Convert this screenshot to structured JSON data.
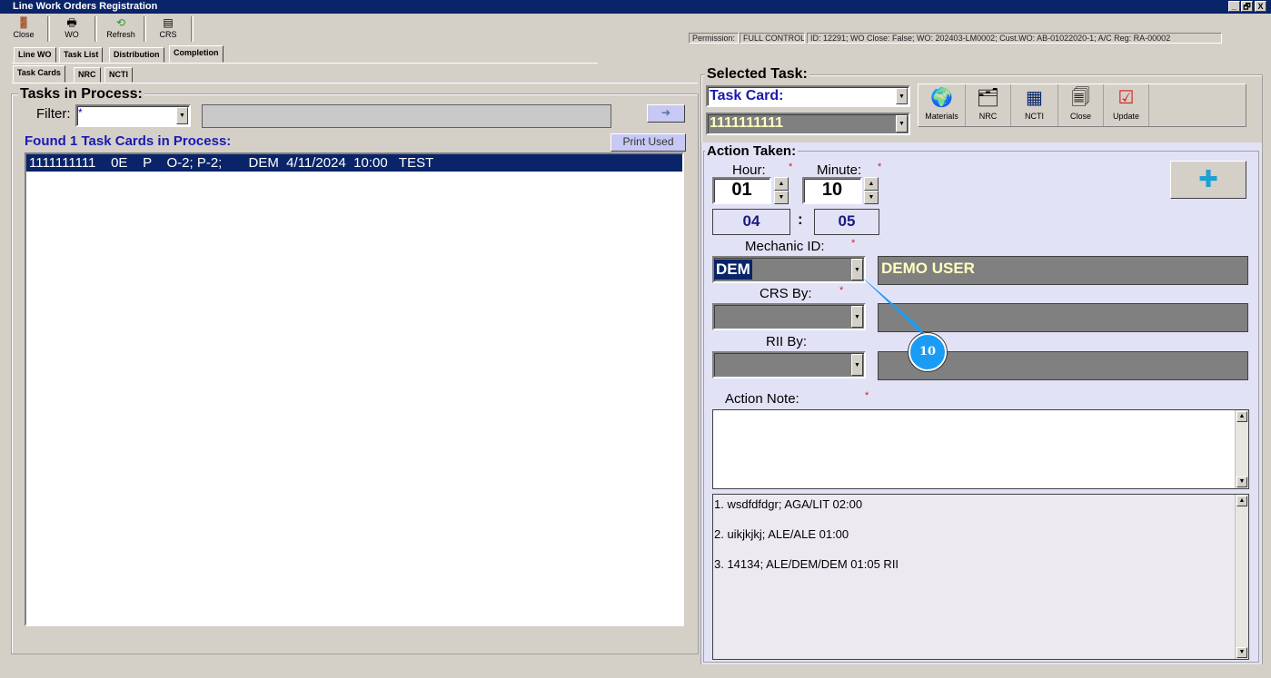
{
  "window": {
    "title": "Line Work Orders Registration",
    "min": "_",
    "max": "🗗",
    "close": "X"
  },
  "toolbar": [
    {
      "label": "Close",
      "icon": "door-exit-icon"
    },
    {
      "label": "WO",
      "icon": "printer-icon"
    },
    {
      "label": "Refresh",
      "icon": "refresh-icon"
    },
    {
      "label": "CRS",
      "icon": "form-edit-icon"
    }
  ],
  "status": {
    "permission_label": "Permission:",
    "permission_value": "FULL CONTROL",
    "info": "ID: 12291; WO Close: False; WO: 202403-LM0002; Cust.WO: AB-01022020-1; A/C Reg: RA-00002"
  },
  "tabs": [
    "Line WO",
    "Task List",
    "Distribution",
    "Completion"
  ],
  "subtabs": [
    "Task Cards",
    "NRC",
    "NCTI"
  ],
  "left": {
    "title": "Tasks in Process:",
    "filter_label": "Filter:",
    "filter_value": "*",
    "arrow": "➔",
    "found": "Found 1 Task Cards in Process:",
    "print_used": "Print Used",
    "rows": [
      "1111111111    0E    P    O-2; P-2;       DEM  4/11/2024  10:00   TEST"
    ]
  },
  "selected": {
    "title": "Selected Task:",
    "type": "Task Card:",
    "number": "1111111111",
    "buttons": [
      {
        "label": "Materials",
        "icon": "🌍"
      },
      {
        "label": "NRC",
        "icon": "🗂"
      },
      {
        "label": "NCTI",
        "icon": "▦"
      },
      {
        "label": "Close",
        "icon": "🗐"
      },
      {
        "label": "Update",
        "icon": "☑"
      }
    ]
  },
  "action": {
    "title": "Action Taken:",
    "hour_label": "Hour:",
    "minute_label": "Minute:",
    "hour": "01",
    "minute": "10",
    "total_h": "04",
    "colon": ":",
    "total_m": "05",
    "mechanic_label": "Mechanic ID:",
    "mechanic_id": "DEM",
    "mechanic_name": "DEMO USER",
    "crs_label": "CRS By:",
    "rii_label": "RII By:",
    "note_label": "Action Note:",
    "req": "*",
    "add": "✚",
    "log": [
      "1. wsdfdfdgr; AGA/LIT  02:00",
      "2. uikjkjkj; ALE/ALE  01:00",
      "3. 14134; ALE/DEM/DEM  01:05  RII"
    ]
  },
  "callout": {
    "number": "10",
    "color": "#1a9cf5"
  }
}
